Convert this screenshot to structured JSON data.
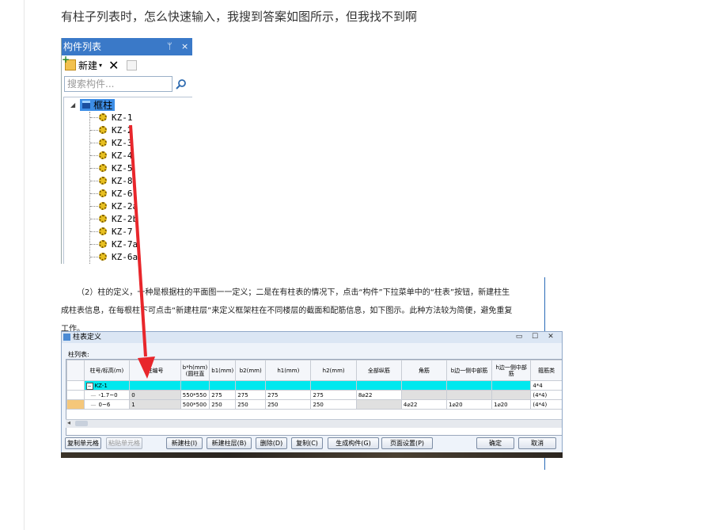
{
  "question": "有柱子列表时，怎么快速输入，我搜到答案如图所示，但我找不到啊",
  "panel": {
    "title": "构件列表",
    "pin": "ᛘ",
    "close": "×",
    "new_label": "新建",
    "search_placeholder": "搜索构件...",
    "root_label": "框柱",
    "items": [
      "KZ-1",
      "KZ-2",
      "KZ-3",
      "KZ-4",
      "KZ-5",
      "KZ-8",
      "KZ-6",
      "KZ-2a",
      "KZ-2b",
      "KZ-7",
      "KZ-7a",
      "KZ-6a"
    ]
  },
  "paragraph": {
    "line1": "（2）柱的定义，一种是根据柱的平面图一一定义；二是在有柱表的情况下，点击“构件”下拉菜单中的“柱表”按钮，新建柱生",
    "line2": "成柱表信息，在每根柱下可点击“新建柱层”来定义框架柱在不同楼层的截面和配筋信息，如下图示。此种方法较为简便，避免重复",
    "line3": "工作。"
  },
  "dialog": {
    "title": "柱表定义",
    "min": "▭",
    "max": "☐",
    "close": "✕",
    "table_label": "柱列表:",
    "headers": [
      "柱号/标高(m)",
      "柱编号",
      "b*h(mm)(圆柱直",
      "b1(mm)",
      "b2(mm)",
      "h1(mm)",
      "h2(mm)",
      "全部纵筋",
      "角筋",
      "b边一侧中部筋",
      "h边一侧中部筋",
      "箍筋类"
    ],
    "rows": [
      {
        "c": [
          "KZ-1",
          "",
          "",
          "",
          "",
          "",
          "",
          "",
          "",
          "",
          "",
          "4*4"
        ]
      },
      {
        "c": [
          "-1.7~0",
          "0",
          "550*550",
          "275",
          "275",
          "275",
          "275",
          "8⌀22",
          "",
          "",
          "",
          "(4*4)"
        ]
      },
      {
        "c": [
          "0~6",
          "1",
          "500*500",
          "250",
          "250",
          "250",
          "250",
          "",
          "4⌀22",
          "1⌀20",
          "1⌀20",
          "(4*4)"
        ]
      }
    ],
    "buttons": {
      "copy_cell": "复制单元格",
      "paste_cell": "粘贴单元格",
      "new_col": "新建柱(I)",
      "new_layer": "新建柱层(B)",
      "delete": "删除(D)",
      "copy": "复制(C)",
      "gen": "生成构件(G)",
      "page": "页面设置(P)",
      "ok": "确定",
      "cancel": "取消"
    }
  },
  "colors": {
    "accent": "#3a79c8",
    "arrow": "#e8262b",
    "row_highlight": "#00e8ee"
  }
}
